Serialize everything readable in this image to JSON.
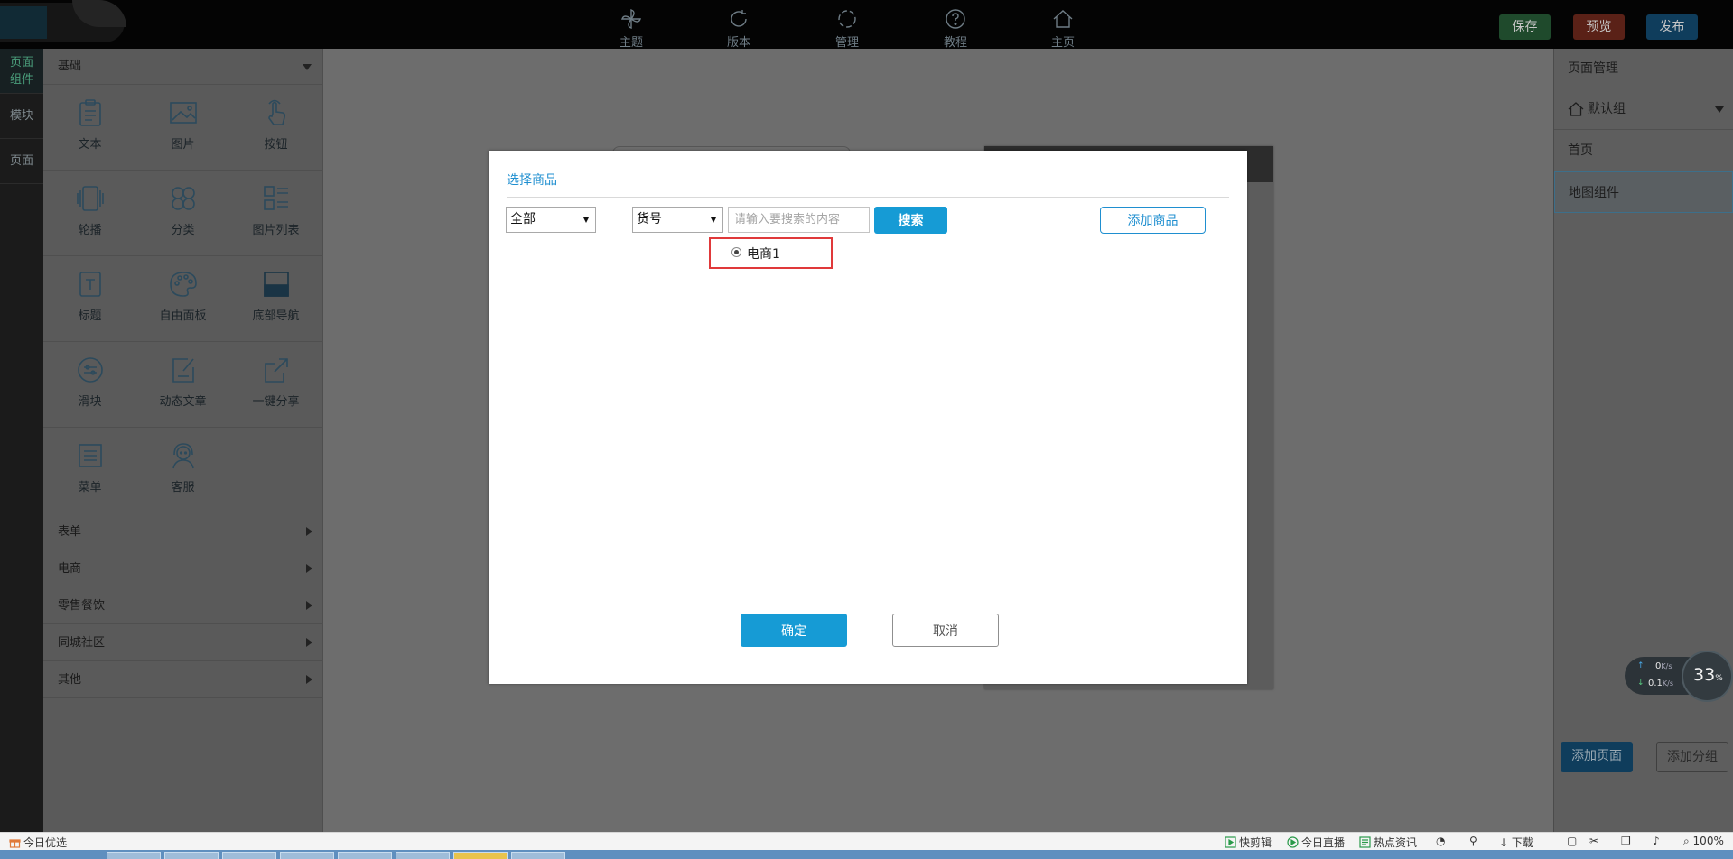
{
  "topnav": [
    {
      "id": "theme",
      "label": "主题",
      "icon": "pinwheel-icon"
    },
    {
      "id": "version",
      "label": "版本",
      "icon": "refresh-icon"
    },
    {
      "id": "manage",
      "label": "管理",
      "icon": "cycle-icon"
    },
    {
      "id": "tutorial",
      "label": "教程",
      "icon": "help-icon"
    },
    {
      "id": "home",
      "label": "主页",
      "icon": "home-icon"
    }
  ],
  "toolbar": {
    "save": "保存",
    "preview": "预览",
    "publish": "发布",
    "colors": {
      "save": "#1f4a2c",
      "preview": "#5a2117",
      "publish": "#0f3d5c"
    }
  },
  "rail": {
    "items": [
      "页面组件",
      "模块",
      "页面"
    ]
  },
  "components": {
    "header": "基础",
    "items": [
      {
        "label": "文本",
        "icon": "clipboard-icon"
      },
      {
        "label": "图片",
        "icon": "image-icon"
      },
      {
        "label": "按钮",
        "icon": "tap-icon"
      },
      {
        "label": "轮播",
        "icon": "carousel-icon"
      },
      {
        "label": "分类",
        "icon": "category-icon"
      },
      {
        "label": "图片列表",
        "icon": "image-list-icon"
      },
      {
        "label": "标题",
        "icon": "title-icon"
      },
      {
        "label": "自由面板",
        "icon": "palette-icon"
      },
      {
        "label": "底部导航",
        "icon": "bottom-nav-icon"
      },
      {
        "label": "滑块",
        "icon": "slider-icon"
      },
      {
        "label": "动态文章",
        "icon": "article-icon"
      },
      {
        "label": "一键分享",
        "icon": "share-icon"
      },
      {
        "label": "菜单",
        "icon": "menu-icon"
      },
      {
        "label": "客服",
        "icon": "support-icon"
      }
    ],
    "categories": [
      "表单",
      "电商",
      "零售餐饮",
      "同城社区",
      "其他"
    ]
  },
  "page_panel": {
    "title": "页面管理",
    "group": "默认组",
    "pages": [
      "首页",
      "地图组件"
    ],
    "add_page": "添加页面",
    "add_group": "添加分组"
  },
  "modal": {
    "title": "选择商品",
    "category_select": "全部",
    "field_select": "货号",
    "search_placeholder": "请输入要搜索的内容",
    "search_button": "搜索",
    "add_goods_button": "添加商品",
    "results": [
      "电商1"
    ],
    "ok_button": "确定",
    "cancel_button": "取消"
  },
  "speed_widget": {
    "up": "0",
    "up_unit": "K/s",
    "down": "0.1",
    "down_unit": "K/s",
    "percent": "33",
    "percent_unit": "%"
  },
  "statusbar": {
    "left": "今日优选",
    "items": [
      "快剪辑",
      "今日直播",
      "热点资讯"
    ],
    "download": "下载",
    "zoom": "100%"
  }
}
